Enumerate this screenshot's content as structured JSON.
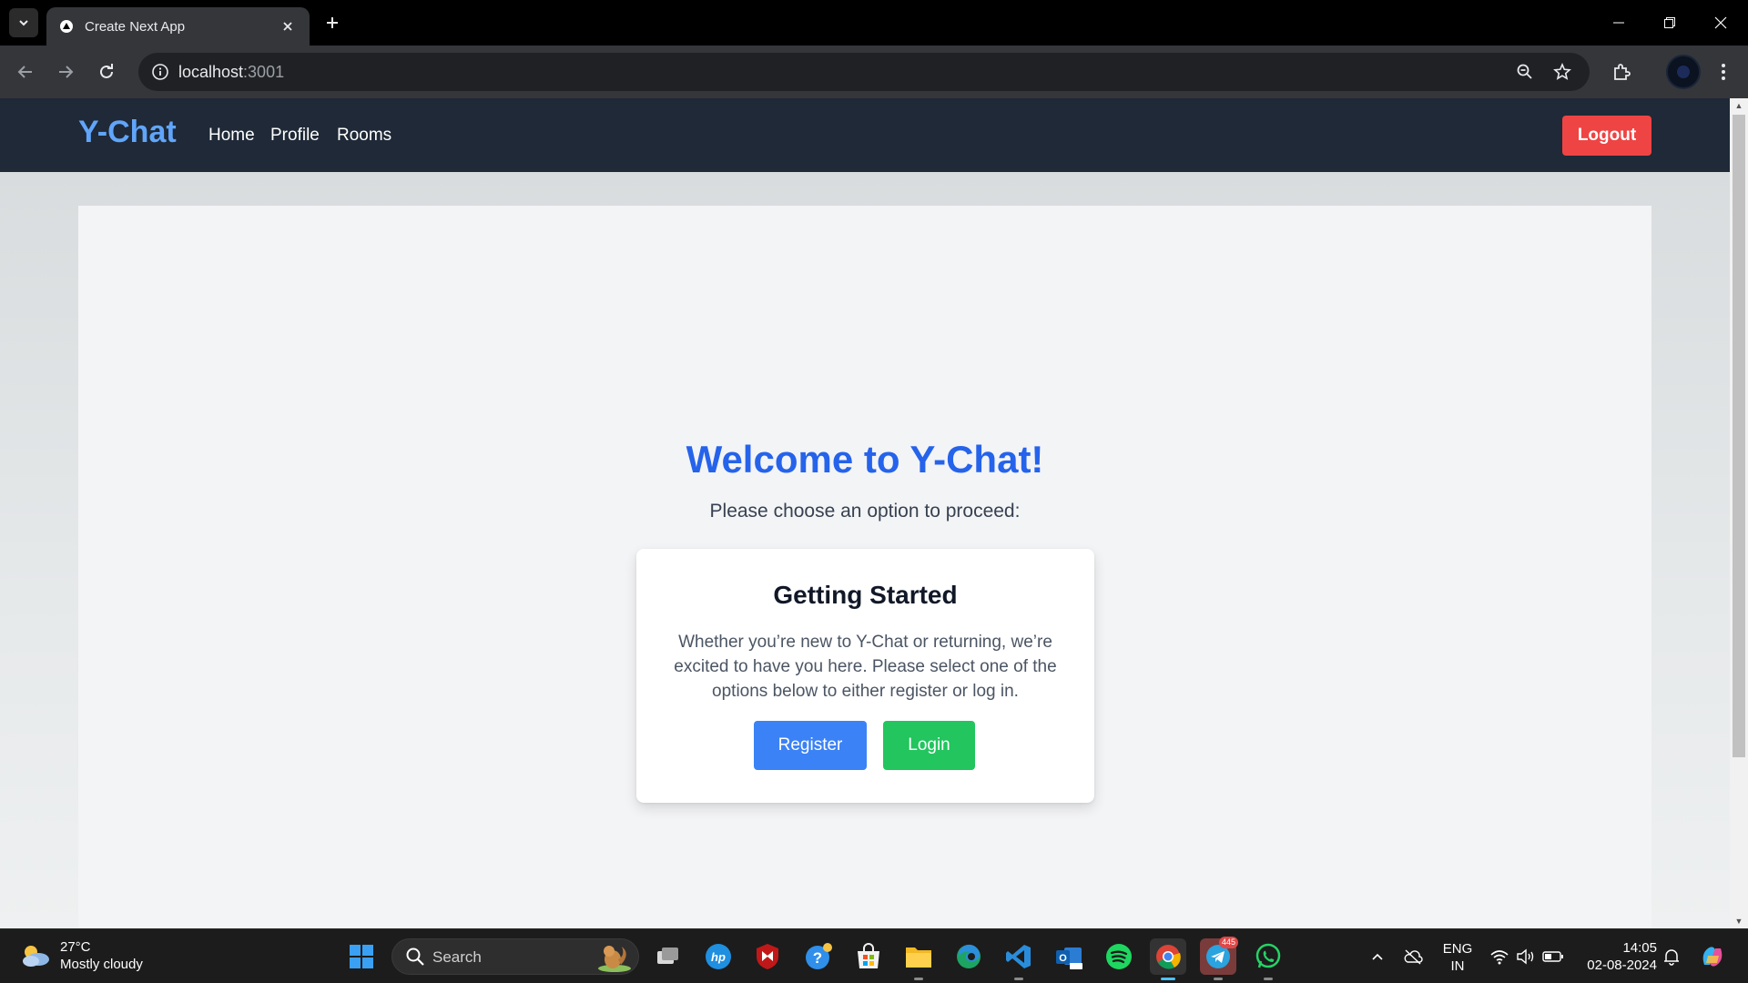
{
  "browser": {
    "tab_title": "Create Next App",
    "url_host": "localhost",
    "url_port": ":3001"
  },
  "app": {
    "brand": "Y-Chat",
    "nav_links": [
      "Home",
      "Profile",
      "Rooms"
    ],
    "logout_label": "Logout",
    "welcome_title": "Welcome to Y-Chat!",
    "welcome_subtitle": "Please choose an option to proceed:",
    "card": {
      "title": "Getting Started",
      "text": "Whether you’re new to Y-Chat or returning, we’re excited to have you here. Please select one of the options below to either register or log in.",
      "register_label": "Register",
      "login_label": "Login"
    }
  },
  "taskbar": {
    "weather_temp": "27°C",
    "weather_desc": "Mostly cloudy",
    "search_placeholder": "Search",
    "language": "ENG",
    "region": "IN",
    "time": "14:05",
    "date": "02-08-2024",
    "telegram_badge": "445",
    "pinned_apps": [
      "start",
      "task-view",
      "hp",
      "mcafee",
      "get-help",
      "microsoft-store",
      "file-explorer",
      "edge",
      "vs-code",
      "outlook",
      "spotify",
      "chrome",
      "telegram",
      "whatsapp"
    ]
  },
  "colors": {
    "brand": "#60a5fa",
    "navbar": "#1f2937",
    "title": "#2563eb",
    "logout": "#ef4444",
    "register": "#3b82f6",
    "login": "#22c55e"
  }
}
